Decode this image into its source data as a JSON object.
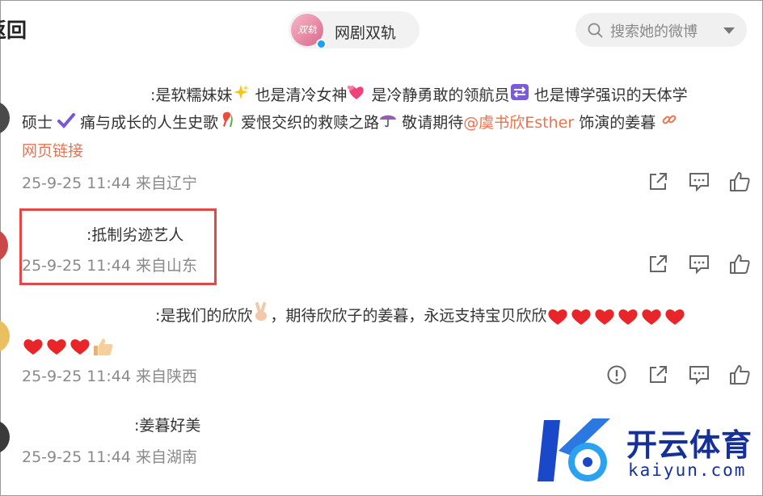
{
  "header": {
    "back_label": "返回",
    "back_visible": "返回",
    "account_name": "网剧双轨",
    "avatar_text": "双轨",
    "search_placeholder": "搜索她的微博"
  },
  "comments": [
    {
      "user": "",
      "text_a": ":是软糯妹妹",
      "text_b": "也是清冷女神",
      "text_c": "是冷静勇敢的领航员",
      "text_d": "也是博学强识的天体学",
      "text_e": "硕士",
      "text_f": "痛与成长的人生史歌",
      "text_g": "爱恨交织的救赎之路",
      "text_h": "敬请期待",
      "mention": "@虞书欣Esther",
      "text_i": "饰演的姜暮",
      "web_link": "网页链接",
      "time": "25-9-25 11:44",
      "location": "来自辽宁"
    },
    {
      "user": "",
      "text": ":抵制劣迹艺人",
      "time": "25-9-25 11:44",
      "location": "来自山东"
    },
    {
      "user": "",
      "text_a": ":是我们的欣欣",
      "text_b": "，期待欣欣子的姜暮，永远支持宝贝欣欣",
      "time": "25-9-25 11:44",
      "location": "来自陕西"
    },
    {
      "user": "",
      "text": ":姜暮好美",
      "time": "25-9-25 11:44",
      "location": "来自湖南"
    }
  ],
  "watermark": {
    "brand_cn": "开云体育",
    "brand_en": "kaiyun.com"
  },
  "icons": [
    "search-icon",
    "chevron-down-icon",
    "share-icon",
    "comment-icon",
    "like-icon",
    "report-icon",
    "sparkle-icon",
    "two-hearts-icon",
    "swap-icon",
    "checkmark-icon",
    "ribbon-icon",
    "umbrella-icon",
    "link-icon",
    "victory-hand-icon",
    "red-heart-icon",
    "thumbs-up-icon"
  ],
  "colors": {
    "link": "#eb7350",
    "meta": "#8a8a8a",
    "highlight": "#e24848",
    "watermark": "#16309a"
  }
}
